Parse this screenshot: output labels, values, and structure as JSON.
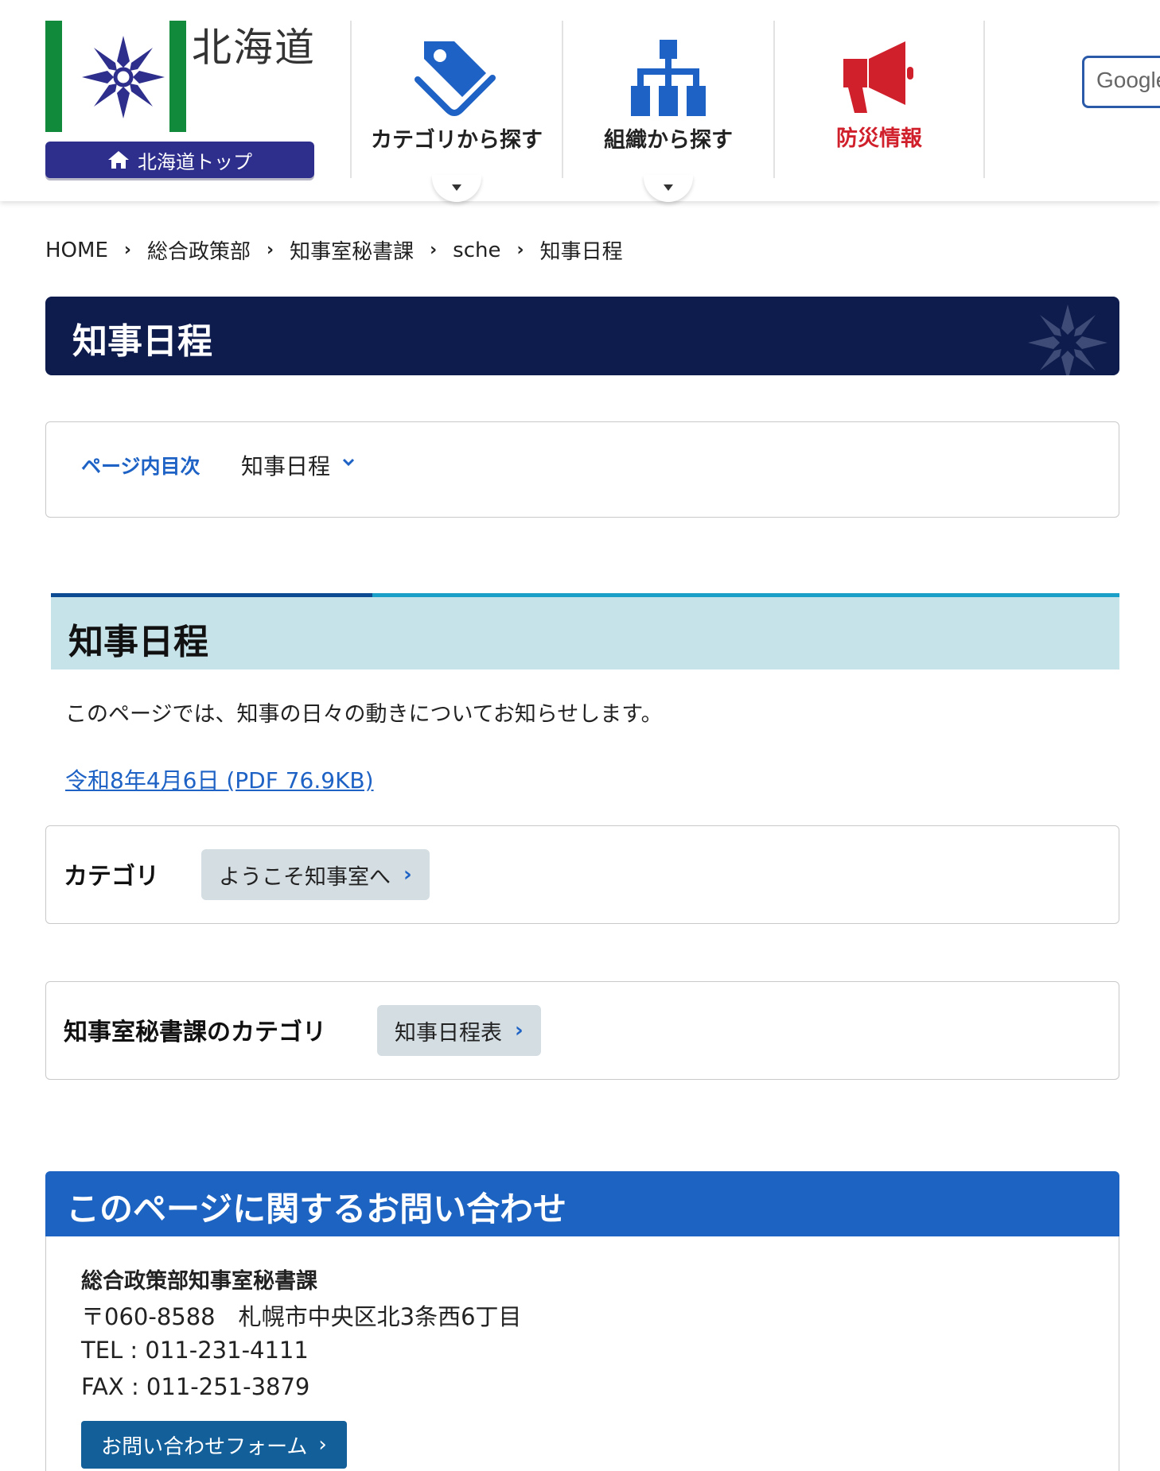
{
  "header": {
    "pref_name": "北海道",
    "top_button": "北海道トップ",
    "nav": [
      {
        "label": "カテゴリから探す"
      },
      {
        "label": "組織から探す"
      },
      {
        "label": "防災情報"
      }
    ],
    "search_button": "Google"
  },
  "breadcrumb": [
    "HOME",
    "総合政策部",
    "知事室秘書課",
    "sche",
    "知事日程"
  ],
  "page_title": "知事日程",
  "toc": {
    "label": "ページ内目次",
    "link": "知事日程"
  },
  "section": {
    "heading": "知事日程",
    "intro": "このページでは、知事の日々の動きについてお知らせします。",
    "pdf_link": "令和8年4月6日 (PDF 76.9KB)"
  },
  "categories": {
    "label": "カテゴリ",
    "chip": "ようこそ知事室へ"
  },
  "dept_categories": {
    "label": "知事室秘書課のカテゴリ",
    "chip": "知事日程表"
  },
  "contact": {
    "heading": "このページに関するお問い合わせ",
    "dept": "総合政策部知事室秘書課",
    "address": "〒060-8588　札幌市中央区北3条西6丁目",
    "tel": "TEL : 011-231-4111",
    "fax": "FAX : 011-251-3879",
    "form_button": "お問い合わせフォーム"
  },
  "colors": {
    "title_bar": "#0d1b4d",
    "accent_blue": "#1d62c4",
    "disaster_red": "#d0202c",
    "flag_green": "#118a3c"
  }
}
